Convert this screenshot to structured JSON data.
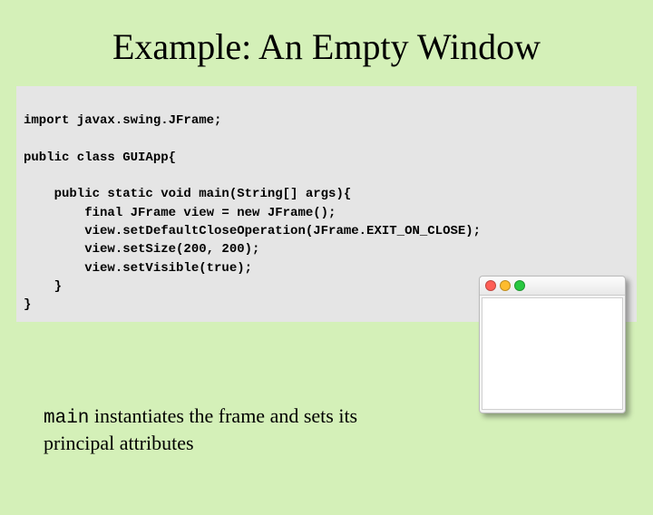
{
  "title": "Example: An Empty Window",
  "code": {
    "l1": "import javax.swing.JFrame;",
    "l2": "",
    "l3": "public class GUIApp{",
    "l4": "",
    "l5": "    public static void main(String[] args){",
    "l6": "        final JFrame view = new JFrame();",
    "l7": "        view.setDefaultCloseOperation(JFrame.EXIT_ON_CLOSE);",
    "l8": "        view.setSize(200, 200);",
    "l9": "        view.setVisible(true);",
    "l10": "    }",
    "l11": "}"
  },
  "caption": {
    "mono": "main",
    "rest": " instantiates the frame and sets its principal attributes"
  }
}
